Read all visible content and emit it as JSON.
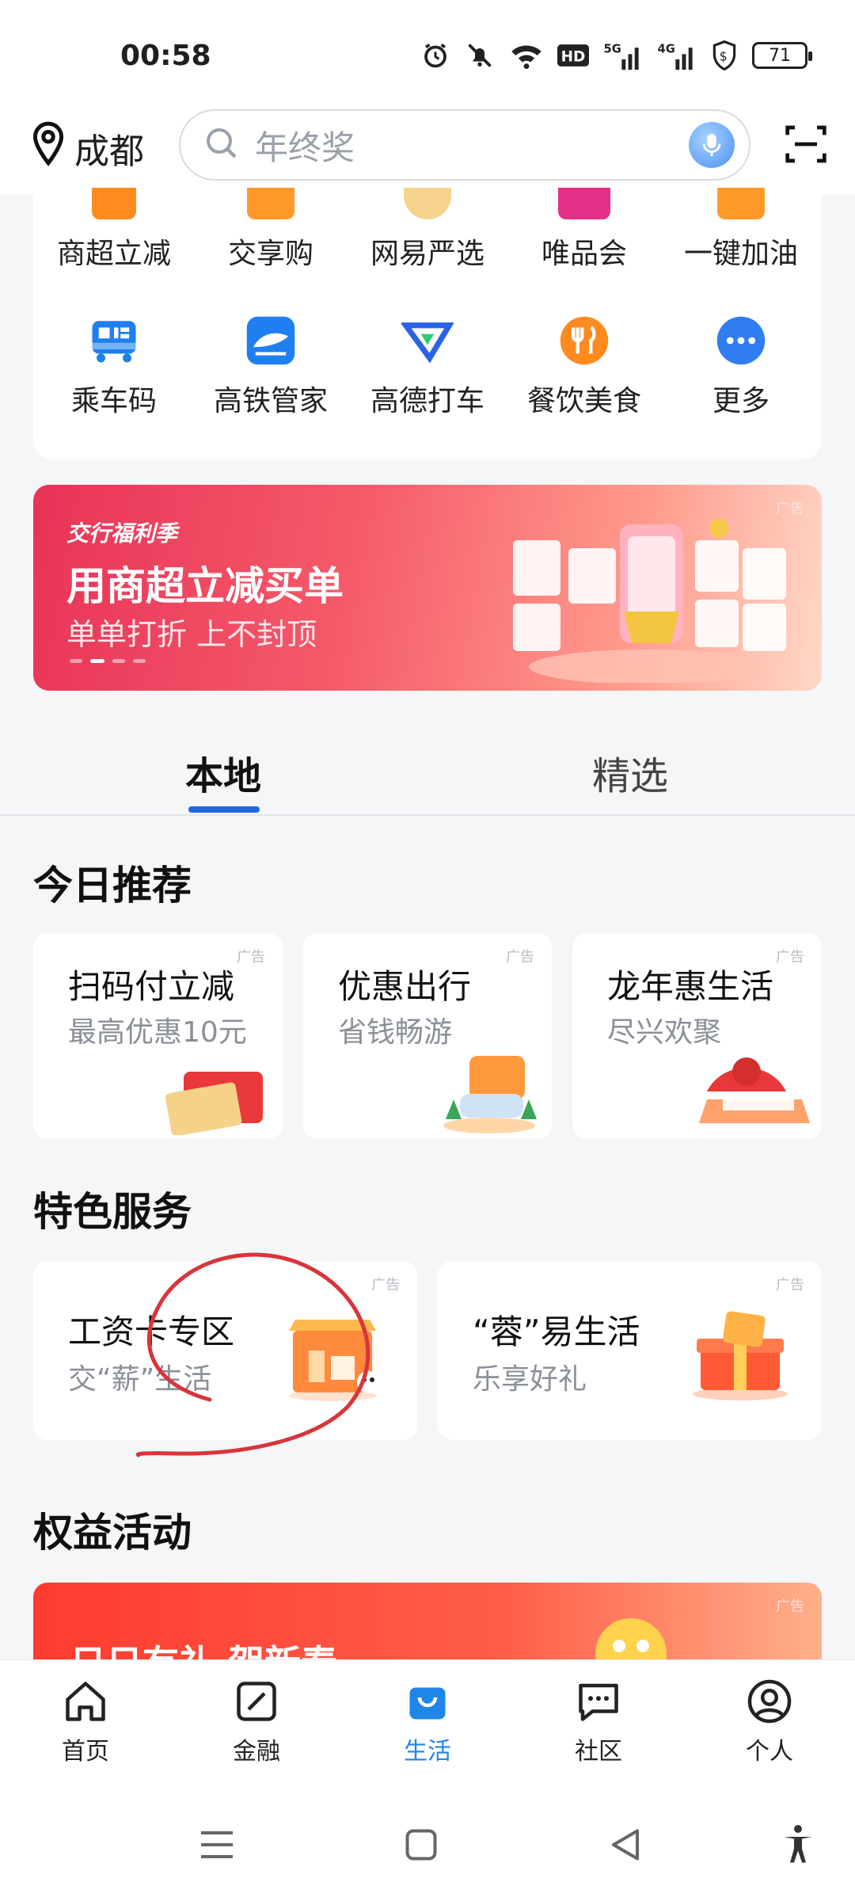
{
  "status_bar": {
    "time": "00:58",
    "battery": "71",
    "icons": [
      "alarm-icon",
      "mute-icon",
      "wifi-icon",
      "hd-icon",
      "signal-5g-icon",
      "signal-4g-icon",
      "shield-dollar-icon",
      "battery-icon"
    ]
  },
  "header": {
    "city": "成都",
    "search_placeholder": "年终奖"
  },
  "services": [
    {
      "label": "商超立减",
      "color": "#ff8a1f"
    },
    {
      "label": "交享购",
      "color": "#ff8a1f"
    },
    {
      "label": "网易严选",
      "color": "#f2b24a"
    },
    {
      "label": "唯品会",
      "color": "#e5308a"
    },
    {
      "label": "一键加油",
      "color": "#ff9a2a"
    },
    {
      "label": "乘车码",
      "color": "#1e7ff0"
    },
    {
      "label": "高铁管家",
      "color": "#1e7ff0"
    },
    {
      "label": "高德打车",
      "color": "#2a63e8"
    },
    {
      "label": "餐饮美食",
      "color": "#ff8a1f"
    },
    {
      "label": "更多",
      "color": "#2f7df0"
    }
  ],
  "banner": {
    "brand": "交行福利季",
    "title": "用商超立减买单",
    "subtitle": "单单打折 上不封顶",
    "ad": "广告"
  },
  "tabs": {
    "local": "本地",
    "featured": "精选"
  },
  "today": {
    "title": "今日推荐",
    "cards": [
      {
        "title": "扫码付立减",
        "subtitle": "最高优惠10元",
        "ad": "广告"
      },
      {
        "title": "优惠出行",
        "subtitle": "省钱畅游",
        "ad": "广告"
      },
      {
        "title": "龙年惠生活",
        "subtitle": "尽兴欢聚",
        "ad": "广告"
      }
    ]
  },
  "special": {
    "title": "特色服务",
    "cards": [
      {
        "title": "工资卡专区",
        "subtitle": "交“薪”生活",
        "ad": "广告"
      },
      {
        "title": "“蓉”易生活",
        "subtitle": "乐享好礼",
        "ad": "广告"
      }
    ]
  },
  "benefits": {
    "title": "权益活动",
    "promo": "日日有礼 贺新春",
    "ad": "广告"
  },
  "bottom_nav": [
    {
      "label": "首页"
    },
    {
      "label": "金融"
    },
    {
      "label": "生活"
    },
    {
      "label": "社区"
    },
    {
      "label": "个人"
    }
  ],
  "colors": {
    "accent_blue": "#2266e0",
    "nav_active": "#1f86e8",
    "banner_red": "#e83357",
    "annotation_red": "#d8343b"
  }
}
